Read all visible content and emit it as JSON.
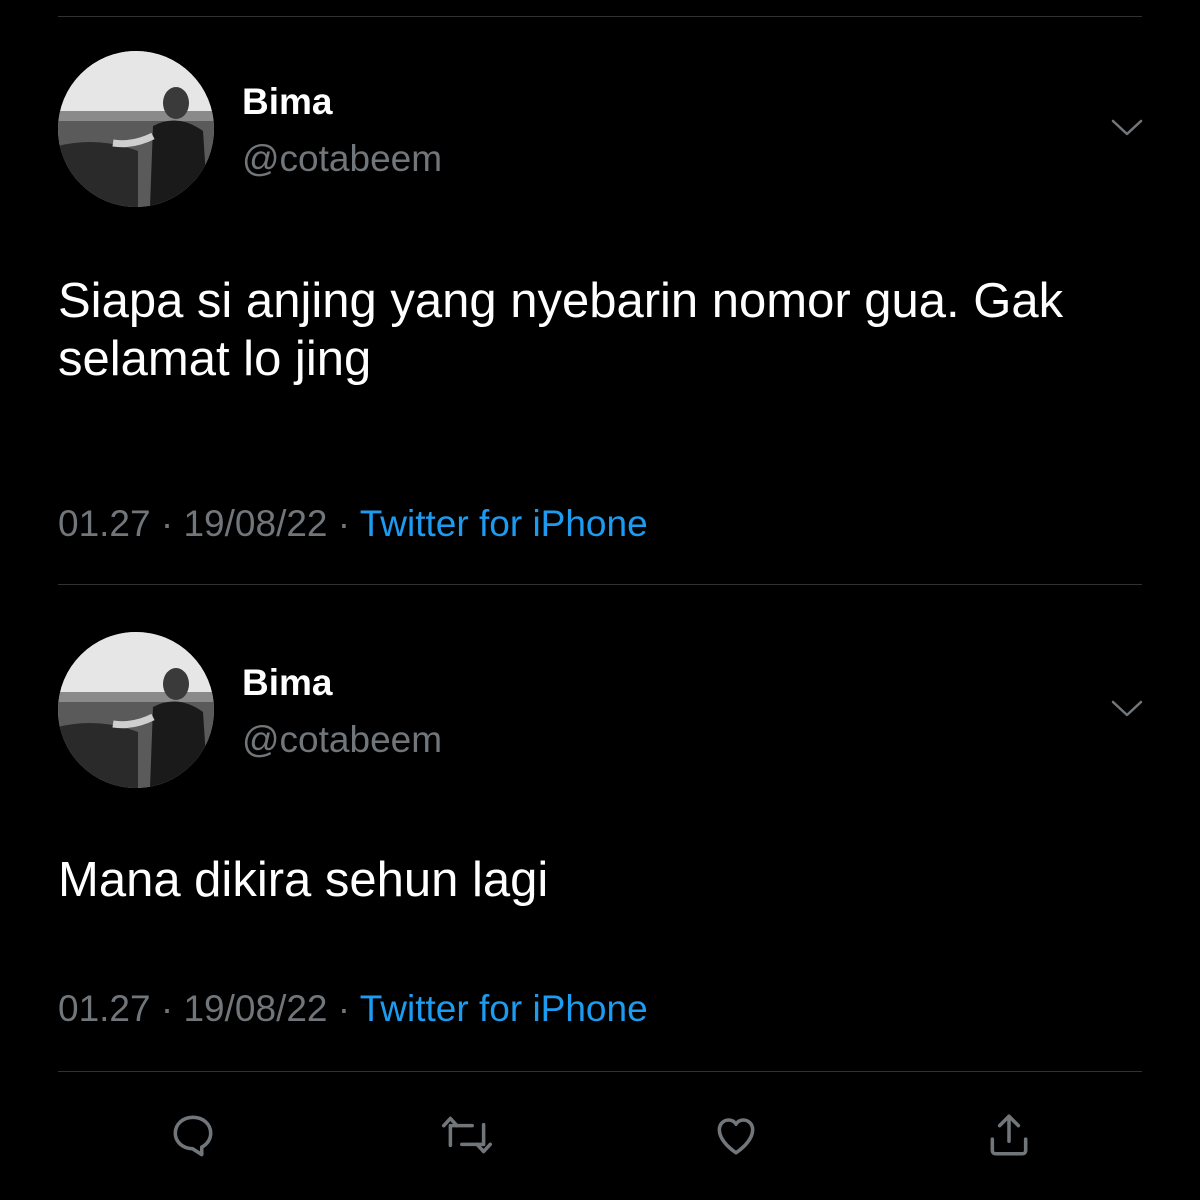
{
  "tweets": [
    {
      "name": "Bima",
      "handle": "@cotabeem",
      "text": "Siapa si anjing yang nyebarin nomor gua. Gak selamat lo jing",
      "time": "01.27",
      "date": "19/08/22",
      "separator": "·",
      "source": "Twitter for iPhone"
    },
    {
      "name": "Bima",
      "handle": "@cotabeem",
      "text": "Mana dikira sehun lagi",
      "time": "01.27",
      "date": "19/08/22",
      "separator": "·",
      "source": "Twitter for iPhone"
    }
  ],
  "actions": {
    "icons": [
      "reply-icon",
      "retweet-icon",
      "like-icon",
      "share-icon"
    ]
  },
  "colors": {
    "background": "#000000",
    "primary_text": "#ffffff",
    "secondary_text": "#71767b",
    "link": "#1d9bf0",
    "divider": "#2f3336"
  }
}
